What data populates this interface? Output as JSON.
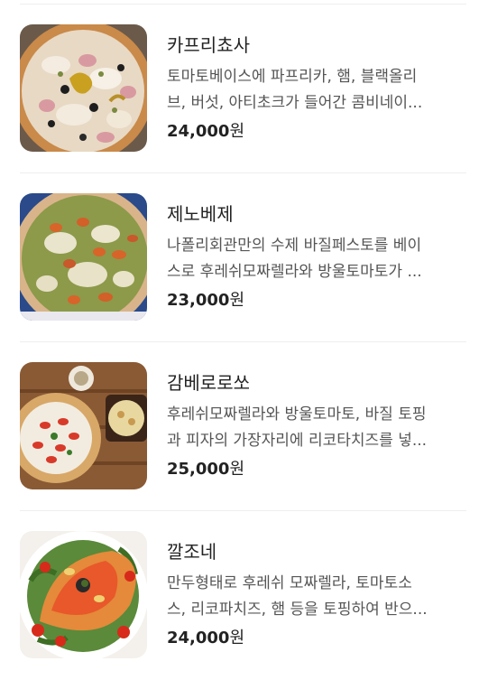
{
  "menu": {
    "items": [
      {
        "name": "카프리쵸사",
        "description_lines": [
          "토마토베이스에 파프리카, 햄, 블랙올리",
          "브, 버섯, 아티초크가 들어간 콤비네이..."
        ],
        "price_amount": "24,000",
        "price_unit": "원",
        "image": "pizza-capricciosa-photo"
      },
      {
        "name": "제노베제",
        "description_lines": [
          "나폴리회관만의 수제 바질페스토를 베이",
          "스로 후레쉬모짜렐라와 방울토마토가 ..."
        ],
        "price_amount": "23,000",
        "price_unit": "원",
        "image": "pizza-genovese-photo"
      },
      {
        "name": "감베로로쏘",
        "description_lines": [
          "후레쉬모짜렐라와 방울토마토, 바질 토핑",
          "과 피자의 가장자리에 리코타치즈를 넣..."
        ],
        "price_amount": "25,000",
        "price_unit": "원",
        "image": "pizza-gamberorosso-photo"
      },
      {
        "name": "깔조네",
        "description_lines": [
          "만두형태로 후레쉬 모짜렐라, 토마토소",
          "스, 리코파치즈, 햄 등을 토핑하여 반으..."
        ],
        "price_amount": "24,000",
        "price_unit": "원",
        "image": "calzone-photo"
      }
    ]
  }
}
